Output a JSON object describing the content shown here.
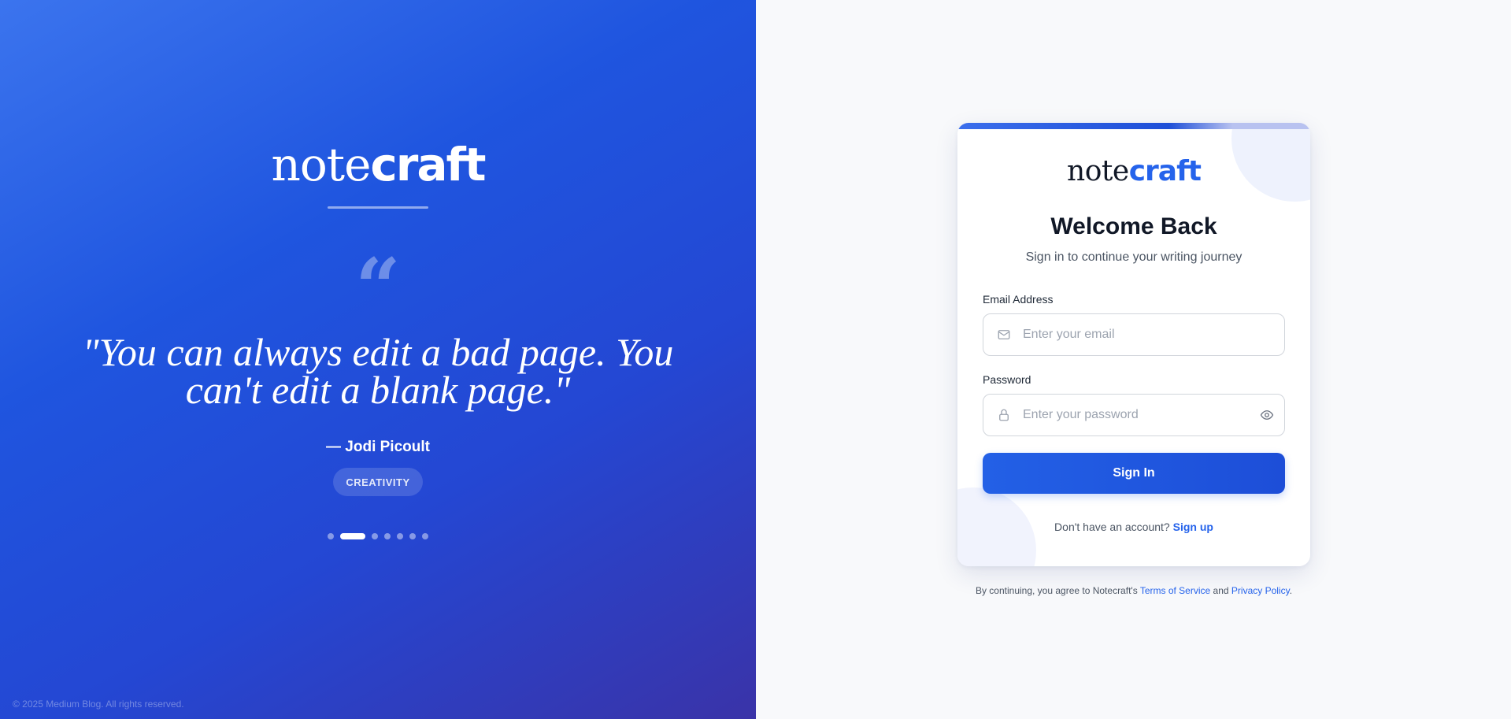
{
  "hero": {
    "logo_light": "note",
    "logo_bold": "craft",
    "quote_mark": "“",
    "quote": "\"You can always edit a bad page. You can't edit a blank page.\"",
    "author": "— Jodi Picoult",
    "tag": "CREATIVITY",
    "carousel": {
      "total_dots": 7,
      "active_index": 1
    },
    "copyright": "© 2025 Medium Blog. All rights reserved."
  },
  "card": {
    "logo_light": "note",
    "logo_bold": "craft",
    "title": "Welcome Back",
    "subtitle": "Sign in to continue your writing journey",
    "email": {
      "label": "Email Address",
      "placeholder": "Enter your email",
      "value": "",
      "icon": "mail-icon"
    },
    "password": {
      "label": "Password",
      "placeholder": "Enter your password",
      "value": "",
      "icon": "lock-icon",
      "toggle_icon": "eye-icon"
    },
    "signin_label": "Sign In",
    "signup_prompt": "Don't have an account?",
    "signup_link": "Sign up"
  },
  "terms": {
    "prefix": "By continuing, you agree to Notecraft's",
    "tos_link": "Terms of Service",
    "and": "and",
    "privacy_link": "Privacy Policy",
    "suffix": "."
  },
  "colors": {
    "accent": "#2563eb",
    "hero_gradient_start": "#3b74ee",
    "hero_gradient_end": "#3a33a8",
    "right_bg": "#f8f9fb"
  }
}
